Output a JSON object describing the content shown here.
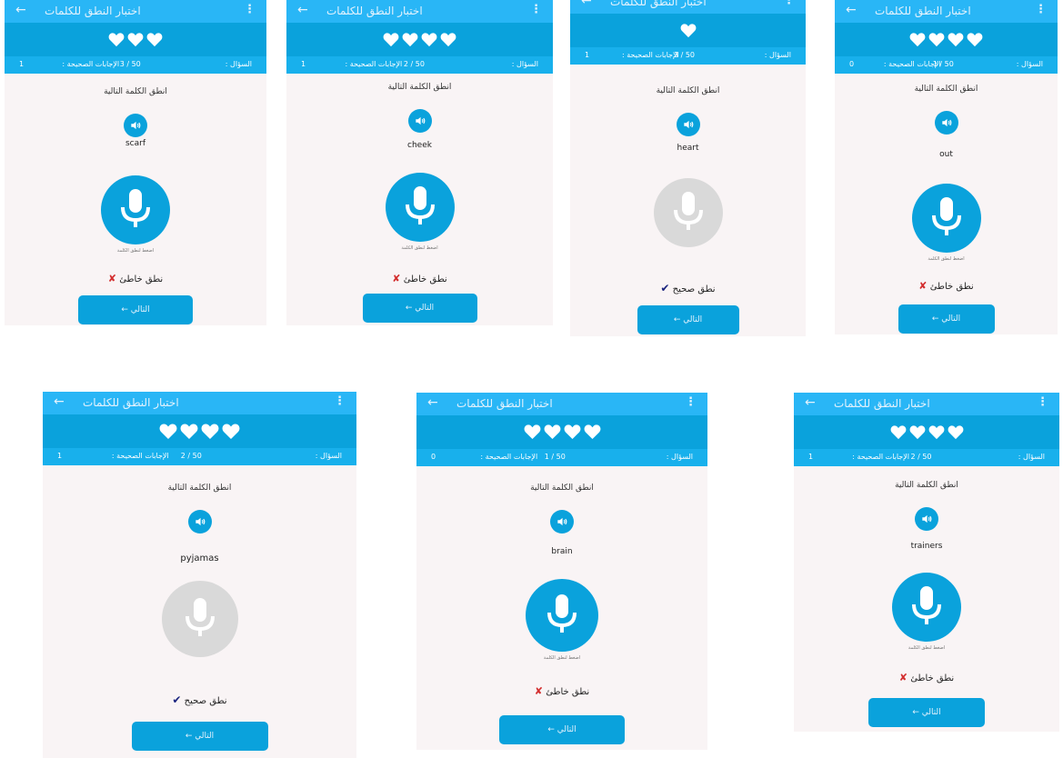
{
  "app": {
    "title": "اختبار النطق للكلمات",
    "back_icon": "arrow-left-icon",
    "menu_icon": "more-vertical-icon",
    "prompt": "انطق الكلمة التالية",
    "hint": "اضغط لنطق الكلمة",
    "next_label": "← التالي",
    "question_label": ": السؤال",
    "correct_label": ": الإجابات الصحيحة",
    "result_wrong": "نطق خاطئ",
    "result_right": "نطق صحيح",
    "wrong_mark": "✘",
    "right_mark": "✔"
  },
  "colors": {
    "appbar": "#29b6f6",
    "hearts_bar": "#0aa2dc",
    "stats_bar": "#18b0ec",
    "mic_active": "#0aa2dc",
    "mic_disabled": "#d9d9d9",
    "wrong": "#d32f2f",
    "right": "#1a237e"
  },
  "screens": [
    {
      "hearts": 3,
      "question": "3 / 50",
      "correct": "1",
      "word": "scarf",
      "mic_state": "active",
      "result": "wrong"
    },
    {
      "hearts": 4,
      "question": "2 / 50",
      "correct": "1",
      "word": "cheek",
      "mic_state": "active",
      "result": "wrong"
    },
    {
      "hearts": 1,
      "question": "3 / 50",
      "correct": "1",
      "word": "heart",
      "mic_state": "disabled",
      "result": "right"
    },
    {
      "hearts": 4,
      "question": "1 / 50",
      "correct": "0",
      "word": "out",
      "mic_state": "active",
      "result": "wrong"
    },
    {
      "hearts": 4,
      "question": "2 / 50",
      "correct": "1",
      "word": "pyjamas",
      "mic_state": "disabled",
      "result": "right"
    },
    {
      "hearts": 4,
      "question": "1 / 50",
      "correct": "0",
      "word": "brain",
      "mic_state": "active",
      "result": "wrong"
    },
    {
      "hearts": 4,
      "question": "2 / 50",
      "correct": "1",
      "word": "trainers",
      "mic_state": "active",
      "result": "wrong"
    }
  ]
}
